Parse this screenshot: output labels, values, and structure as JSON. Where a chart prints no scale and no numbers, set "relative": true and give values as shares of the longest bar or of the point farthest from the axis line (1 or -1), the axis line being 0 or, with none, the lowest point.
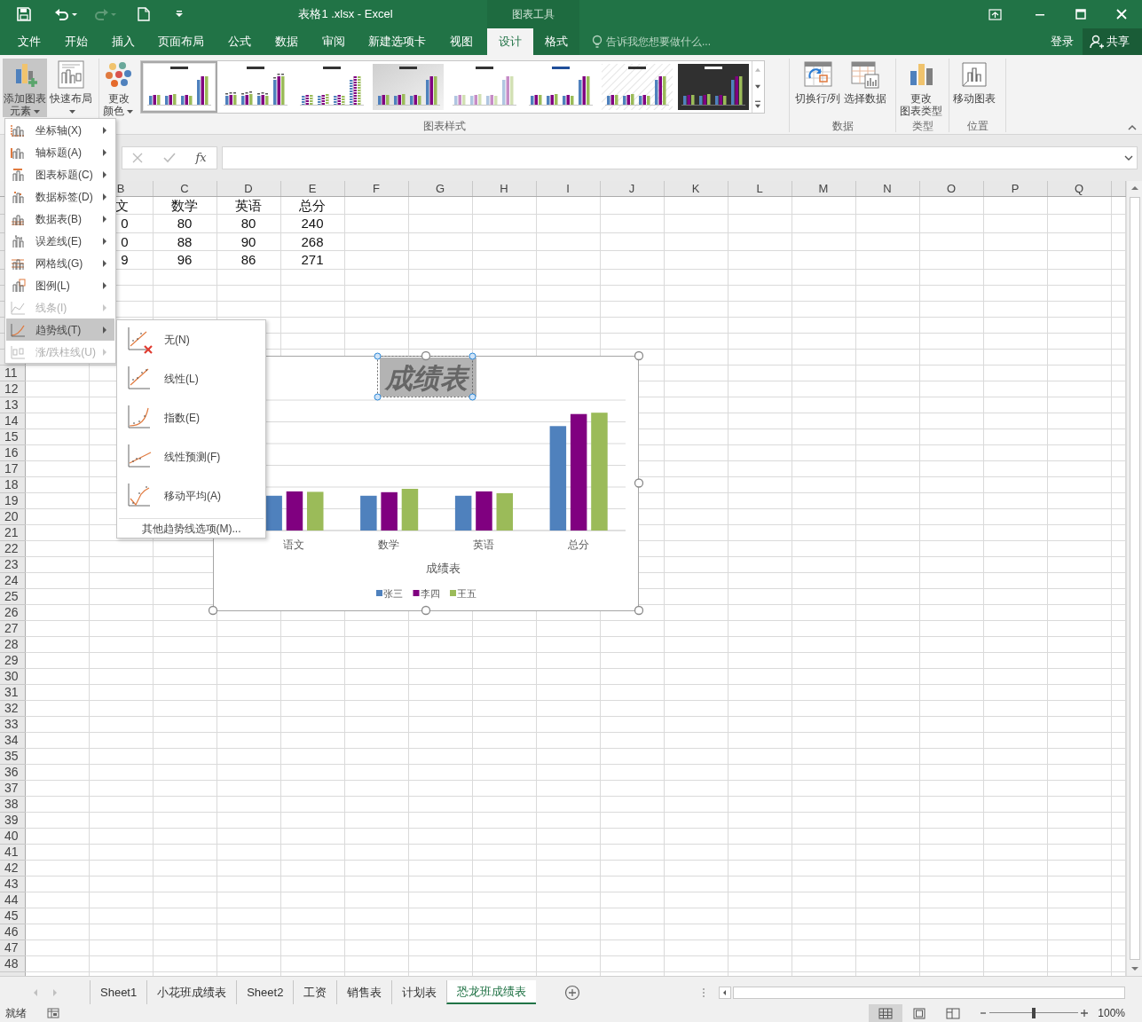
{
  "title_bar": {
    "title": "表格1 .xlsx - Excel",
    "context_label": "图表工具"
  },
  "tabs": [
    {
      "label": "文件",
      "selected": false,
      "contextual": false
    },
    {
      "label": "开始",
      "selected": false,
      "contextual": false
    },
    {
      "label": "插入",
      "selected": false,
      "contextual": false
    },
    {
      "label": "页面布局",
      "selected": false,
      "contextual": false
    },
    {
      "label": "公式",
      "selected": false,
      "contextual": false
    },
    {
      "label": "数据",
      "selected": false,
      "contextual": false
    },
    {
      "label": "审阅",
      "selected": false,
      "contextual": false
    },
    {
      "label": "新建选项卡",
      "selected": false,
      "contextual": false
    },
    {
      "label": "视图",
      "selected": false,
      "contextual": false
    },
    {
      "label": "设计",
      "selected": true,
      "contextual": true
    },
    {
      "label": "格式",
      "selected": false,
      "contextual": true
    }
  ],
  "tell_me": {
    "placeholder": "告诉我您想要做什么..."
  },
  "account": {
    "sign_in": "登录",
    "share": "共享"
  },
  "ribbon": {
    "groups": [
      {
        "buttons": [
          {
            "kind": "add_element",
            "lines": [
              "添加图表",
              "元素"
            ],
            "dropdown": true,
            "pressed": true
          },
          {
            "kind": "quick_layout",
            "lines": [
              "快速布局"
            ],
            "dropdown": true,
            "pressed": false
          }
        ]
      },
      {
        "label": "图表样式",
        "buttons": [
          {
            "kind": "colors",
            "lines": [
              "更改",
              "颜色"
            ],
            "dropdown": true,
            "pressed": false
          }
        ],
        "gallery": [
          {
            "kind": "plain",
            "selected": true
          },
          {
            "kind": "labeled",
            "selected": false
          },
          {
            "kind": "striped",
            "selected": false
          },
          {
            "kind": "gradient",
            "selected": false
          },
          {
            "kind": "pale",
            "selected": false
          },
          {
            "kind": "outlined",
            "selected": false
          },
          {
            "kind": "hatched",
            "selected": false
          },
          {
            "kind": "dark",
            "selected": false
          }
        ]
      },
      {
        "label": "数据",
        "buttons": [
          {
            "kind": "switch",
            "lines": [
              "切换行/列"
            ],
            "dropdown": false,
            "pressed": false
          },
          {
            "kind": "select_data",
            "lines": [
              "选择数据"
            ],
            "dropdown": false,
            "pressed": false
          }
        ]
      },
      {
        "label": "类型",
        "buttons": [
          {
            "kind": "change_type",
            "lines": [
              "更改",
              "图表类型"
            ],
            "dropdown": false,
            "pressed": false
          }
        ]
      },
      {
        "label": "位置",
        "buttons": [
          {
            "kind": "move",
            "lines": [
              "移动图表"
            ],
            "dropdown": false,
            "pressed": false
          }
        ]
      }
    ]
  },
  "formula_bar": {
    "function_label": "fx"
  },
  "add_element_menu": {
    "items": [
      {
        "kind": "axes",
        "label": "坐标轴(X)",
        "disabled": false,
        "expanded": false
      },
      {
        "kind": "axis_titles",
        "label": "轴标题(A)",
        "disabled": false,
        "expanded": false
      },
      {
        "kind": "chart_title",
        "label": "图表标题(C)",
        "disabled": false,
        "expanded": false
      },
      {
        "kind": "data_labels",
        "label": "数据标签(D)",
        "disabled": false,
        "expanded": false
      },
      {
        "kind": "data_table",
        "label": "数据表(B)",
        "disabled": false,
        "expanded": false
      },
      {
        "kind": "error_bars",
        "label": "误差线(E)",
        "disabled": false,
        "expanded": false
      },
      {
        "kind": "gridlines",
        "label": "网格线(G)",
        "disabled": false,
        "expanded": false
      },
      {
        "kind": "legend",
        "label": "图例(L)",
        "disabled": false,
        "expanded": false
      },
      {
        "kind": "lines",
        "label": "线条(I)",
        "disabled": true,
        "expanded": false
      },
      {
        "kind": "trendline",
        "label": "趋势线(T)",
        "disabled": false,
        "expanded": true
      },
      {
        "kind": "updown",
        "label": "涨/跌柱线(U)",
        "disabled": true,
        "expanded": false
      }
    ]
  },
  "trendline_menu": {
    "items": [
      {
        "kind": "none",
        "label": "无(N)"
      },
      {
        "kind": "linear",
        "label": "线性(L)"
      },
      {
        "kind": "exponential",
        "label": "指数(E)"
      },
      {
        "kind": "forecast",
        "label": "线性预测(F)"
      },
      {
        "kind": "moving_average",
        "label": "移动平均(A)"
      }
    ],
    "footer": "其他趋势线选项(M)..."
  },
  "grid": {
    "column_headers": [
      "B",
      "C",
      "D",
      "E",
      "F",
      "G",
      "H",
      "I",
      "J",
      "K",
      "L",
      "M",
      "N",
      "O",
      "P",
      "Q"
    ],
    "row_headers": [
      "11",
      "12",
      "13",
      "14",
      "15",
      "16",
      "17",
      "18",
      "19",
      "20",
      "21",
      "22",
      "23",
      "24",
      "25",
      "26",
      "27",
      "28",
      "29",
      "30",
      "31",
      "32",
      "33",
      "34",
      "35",
      "36",
      "37",
      "38",
      "39",
      "40",
      "41",
      "42",
      "43",
      "44",
      "45",
      "46",
      "47",
      "48"
    ],
    "cells": [
      [
        "文",
        "数学",
        "英语",
        "总分"
      ],
      [
        "0",
        "80",
        "80",
        "240"
      ],
      [
        "0",
        "88",
        "90",
        "268"
      ],
      [
        "9",
        "96",
        "86",
        "271"
      ]
    ]
  },
  "chart": {
    "title_selected": true,
    "chart_data": {
      "type": "bar",
      "title": "成绩表",
      "xlabel": "成绩表",
      "categories": [
        "语文",
        "数学",
        "英语",
        "总分"
      ],
      "series": [
        {
          "name": "张三",
          "color": "#4f81bd",
          "values": [
            0.295,
            0.295,
            0.295,
            0.886
          ]
        },
        {
          "name": "李四",
          "color": "#800080",
          "values": [
            0.332,
            0.325,
            0.332,
            0.989
          ]
        },
        {
          "name": "王五",
          "color": "#9bbb59",
          "values": [
            0.328,
            0.354,
            0.317,
            1
          ]
        }
      ],
      "relative": true,
      "legend": "bottom"
    }
  },
  "sheet_tabs": [
    {
      "label": "Sheet1",
      "selected": false
    },
    {
      "label": "小花班成绩表",
      "selected": false
    },
    {
      "label": "Sheet2",
      "selected": false
    },
    {
      "label": "工资",
      "selected": false
    },
    {
      "label": "销售表",
      "selected": false
    },
    {
      "label": "计划表",
      "selected": false
    },
    {
      "label": "恐龙班成绩表",
      "selected": true
    }
  ],
  "status_bar": {
    "status": "就绪",
    "views": [
      {
        "kind": "normal",
        "selected": true
      },
      {
        "kind": "page_layout",
        "selected": false
      },
      {
        "kind": "page_break",
        "selected": false
      }
    ],
    "zoom": {
      "level": 0.5
    },
    "zoom_label": "100%"
  }
}
